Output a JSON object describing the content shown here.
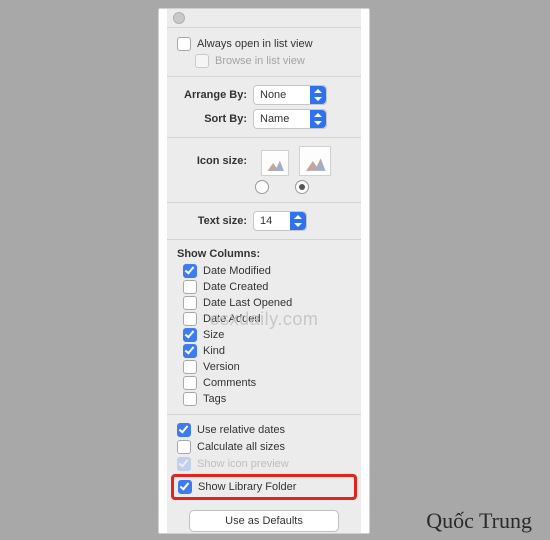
{
  "top": {
    "always_open_label": "Always open in list view",
    "always_open_checked": false,
    "browse_label": "Browse in list view",
    "browse_checked": false
  },
  "arrange": {
    "label": "Arrange By:",
    "value": "None"
  },
  "sort": {
    "label": "Sort By:",
    "value": "Name"
  },
  "icon_size_label": "Icon size:",
  "text_size": {
    "label": "Text size:",
    "value": "14"
  },
  "columns_title": "Show Columns:",
  "columns": [
    {
      "label": "Date Modified",
      "checked": true
    },
    {
      "label": "Date Created",
      "checked": false
    },
    {
      "label": "Date Last Opened",
      "checked": false
    },
    {
      "label": "Date Added",
      "checked": false
    },
    {
      "label": "Size",
      "checked": true
    },
    {
      "label": "Kind",
      "checked": true
    },
    {
      "label": "Version",
      "checked": false
    },
    {
      "label": "Comments",
      "checked": false
    },
    {
      "label": "Tags",
      "checked": false
    }
  ],
  "extra": {
    "relative_dates": {
      "label": "Use relative dates",
      "checked": true
    },
    "calc_sizes": {
      "label": "Calculate all sizes",
      "checked": false
    },
    "icon_preview": {
      "label": "Show icon preview",
      "checked": true
    }
  },
  "show_library": {
    "label": "Show Library Folder",
    "checked": true
  },
  "defaults_button": "Use as Defaults",
  "watermark": "osxdaily.com",
  "signature": "Quốc Trung"
}
